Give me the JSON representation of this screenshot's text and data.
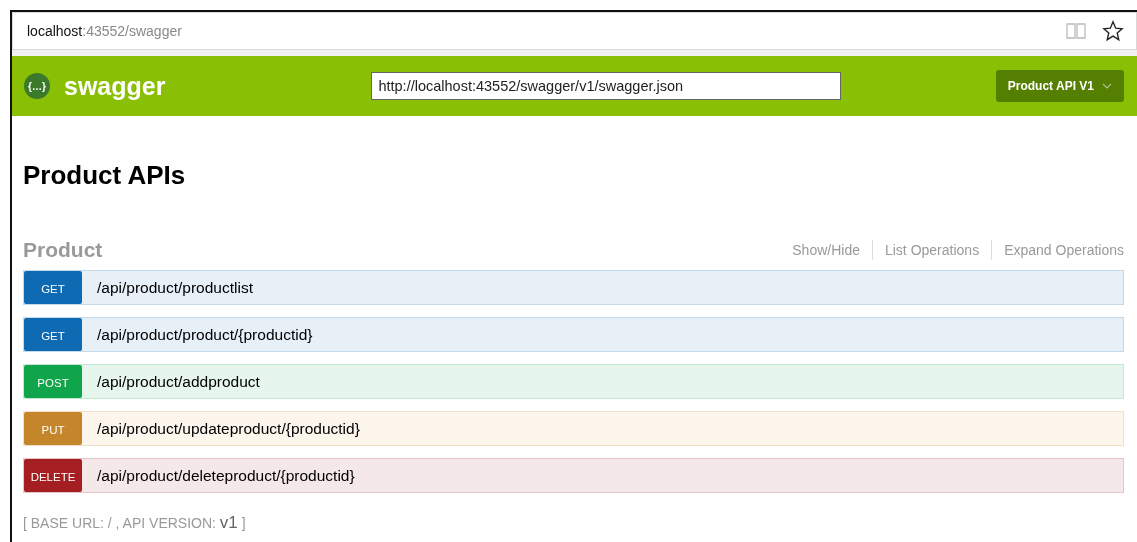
{
  "browser": {
    "url_host": "localhost",
    "url_rest": ":43552/swagger"
  },
  "header": {
    "logo_glyph": "{…}",
    "brand": "swagger",
    "spec_url": "http://localhost:43552/swagger/v1/swagger.json",
    "api_select": "Product API V1"
  },
  "title": "Product APIs",
  "resource": {
    "name": "Product",
    "actions": [
      "Show/Hide",
      "List Operations",
      "Expand Operations"
    ]
  },
  "operations": [
    {
      "kind": "get",
      "method": "GET",
      "path": "/api/product/productlist"
    },
    {
      "kind": "get",
      "method": "GET",
      "path": "/api/product/product/{productid}"
    },
    {
      "kind": "post",
      "method": "POST",
      "path": "/api/product/addproduct"
    },
    {
      "kind": "put",
      "method": "PUT",
      "path": "/api/product/updateproduct/{productid}"
    },
    {
      "kind": "delete",
      "method": "DELETE",
      "path": "/api/product/deleteproduct/{productid}"
    }
  ],
  "footer": "[ BASE URL: / , API VERSION: **v1** ]"
}
